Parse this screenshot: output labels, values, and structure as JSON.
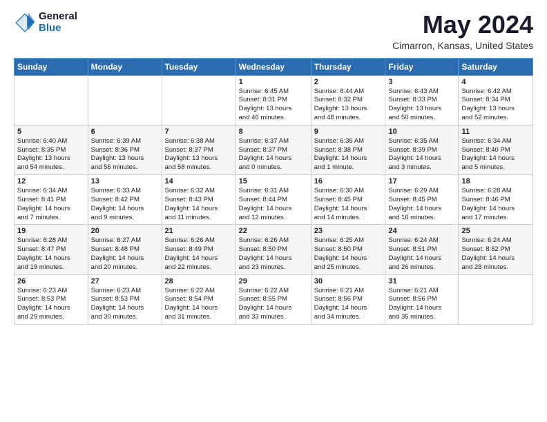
{
  "logo": {
    "general": "General",
    "blue": "Blue"
  },
  "title": "May 2024",
  "location": "Cimarron, Kansas, United States",
  "weekdays": [
    "Sunday",
    "Monday",
    "Tuesday",
    "Wednesday",
    "Thursday",
    "Friday",
    "Saturday"
  ],
  "weeks": [
    [
      {
        "day": "",
        "info": ""
      },
      {
        "day": "",
        "info": ""
      },
      {
        "day": "",
        "info": ""
      },
      {
        "day": "1",
        "info": "Sunrise: 6:45 AM\nSunset: 8:31 PM\nDaylight: 13 hours\nand 46 minutes."
      },
      {
        "day": "2",
        "info": "Sunrise: 6:44 AM\nSunset: 8:32 PM\nDaylight: 13 hours\nand 48 minutes."
      },
      {
        "day": "3",
        "info": "Sunrise: 6:43 AM\nSunset: 8:33 PM\nDaylight: 13 hours\nand 50 minutes."
      },
      {
        "day": "4",
        "info": "Sunrise: 6:42 AM\nSunset: 8:34 PM\nDaylight: 13 hours\nand 52 minutes."
      }
    ],
    [
      {
        "day": "5",
        "info": "Sunrise: 6:40 AM\nSunset: 8:35 PM\nDaylight: 13 hours\nand 54 minutes."
      },
      {
        "day": "6",
        "info": "Sunrise: 6:39 AM\nSunset: 8:36 PM\nDaylight: 13 hours\nand 56 minutes."
      },
      {
        "day": "7",
        "info": "Sunrise: 6:38 AM\nSunset: 8:37 PM\nDaylight: 13 hours\nand 58 minutes."
      },
      {
        "day": "8",
        "info": "Sunrise: 6:37 AM\nSunset: 8:37 PM\nDaylight: 14 hours\nand 0 minutes."
      },
      {
        "day": "9",
        "info": "Sunrise: 6:36 AM\nSunset: 8:38 PM\nDaylight: 14 hours\nand 1 minute."
      },
      {
        "day": "10",
        "info": "Sunrise: 6:35 AM\nSunset: 8:39 PM\nDaylight: 14 hours\nand 3 minutes."
      },
      {
        "day": "11",
        "info": "Sunrise: 6:34 AM\nSunset: 8:40 PM\nDaylight: 14 hours\nand 5 minutes."
      }
    ],
    [
      {
        "day": "12",
        "info": "Sunrise: 6:34 AM\nSunset: 8:41 PM\nDaylight: 14 hours\nand 7 minutes."
      },
      {
        "day": "13",
        "info": "Sunrise: 6:33 AM\nSunset: 8:42 PM\nDaylight: 14 hours\nand 9 minutes."
      },
      {
        "day": "14",
        "info": "Sunrise: 6:32 AM\nSunset: 8:43 PM\nDaylight: 14 hours\nand 11 minutes."
      },
      {
        "day": "15",
        "info": "Sunrise: 6:31 AM\nSunset: 8:44 PM\nDaylight: 14 hours\nand 12 minutes."
      },
      {
        "day": "16",
        "info": "Sunrise: 6:30 AM\nSunset: 8:45 PM\nDaylight: 14 hours\nand 14 minutes."
      },
      {
        "day": "17",
        "info": "Sunrise: 6:29 AM\nSunset: 8:45 PM\nDaylight: 14 hours\nand 16 minutes."
      },
      {
        "day": "18",
        "info": "Sunrise: 6:28 AM\nSunset: 8:46 PM\nDaylight: 14 hours\nand 17 minutes."
      }
    ],
    [
      {
        "day": "19",
        "info": "Sunrise: 6:28 AM\nSunset: 8:47 PM\nDaylight: 14 hours\nand 19 minutes."
      },
      {
        "day": "20",
        "info": "Sunrise: 6:27 AM\nSunset: 8:48 PM\nDaylight: 14 hours\nand 20 minutes."
      },
      {
        "day": "21",
        "info": "Sunrise: 6:26 AM\nSunset: 8:49 PM\nDaylight: 14 hours\nand 22 minutes."
      },
      {
        "day": "22",
        "info": "Sunrise: 6:26 AM\nSunset: 8:50 PM\nDaylight: 14 hours\nand 23 minutes."
      },
      {
        "day": "23",
        "info": "Sunrise: 6:25 AM\nSunset: 8:50 PM\nDaylight: 14 hours\nand 25 minutes."
      },
      {
        "day": "24",
        "info": "Sunrise: 6:24 AM\nSunset: 8:51 PM\nDaylight: 14 hours\nand 26 minutes."
      },
      {
        "day": "25",
        "info": "Sunrise: 6:24 AM\nSunset: 8:52 PM\nDaylight: 14 hours\nand 28 minutes."
      }
    ],
    [
      {
        "day": "26",
        "info": "Sunrise: 6:23 AM\nSunset: 8:53 PM\nDaylight: 14 hours\nand 29 minutes."
      },
      {
        "day": "27",
        "info": "Sunrise: 6:23 AM\nSunset: 8:53 PM\nDaylight: 14 hours\nand 30 minutes."
      },
      {
        "day": "28",
        "info": "Sunrise: 6:22 AM\nSunset: 8:54 PM\nDaylight: 14 hours\nand 31 minutes."
      },
      {
        "day": "29",
        "info": "Sunrise: 6:22 AM\nSunset: 8:55 PM\nDaylight: 14 hours\nand 33 minutes."
      },
      {
        "day": "30",
        "info": "Sunrise: 6:21 AM\nSunset: 8:56 PM\nDaylight: 14 hours\nand 34 minutes."
      },
      {
        "day": "31",
        "info": "Sunrise: 6:21 AM\nSunset: 8:56 PM\nDaylight: 14 hours\nand 35 minutes."
      },
      {
        "day": "",
        "info": ""
      }
    ]
  ]
}
